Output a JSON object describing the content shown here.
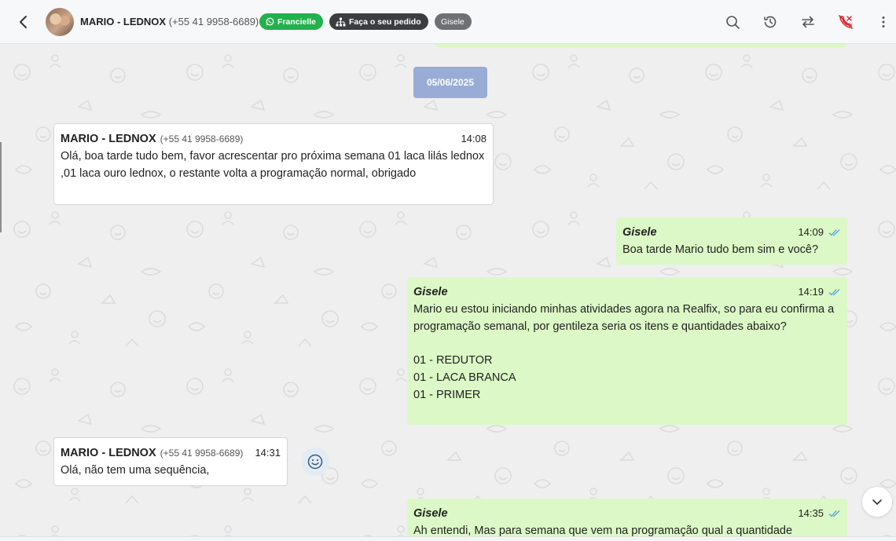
{
  "header": {
    "contact_name": "MARIO - LEDNOX",
    "contact_phone": "(+55 41 9958-6689)",
    "tag_whatsapp": "Francielle",
    "tag_order": "Faça o seu pedido",
    "tag_user": "Gisele",
    "icons": [
      "back-icon",
      "search-icon",
      "history-icon",
      "transfer-icon",
      "end-call-icon",
      "more-icon"
    ],
    "accent_color": "#22b14c",
    "danger_color": "#d9262b"
  },
  "chat": {
    "date_separator": "05/06/2025",
    "messages": [
      {
        "direction": "in",
        "sender": "MARIO - LEDNOX",
        "phone": "(+55 41 9958-6689)",
        "time": "14:08",
        "text": "Olá, boa tarde tudo bem, favor acrescentar pro próxima semana 01 laca lilás lednox ,01 laca ouro lednox, o restante volta a programação normal, obrigado"
      },
      {
        "direction": "out",
        "sender": "Gisele",
        "time": "14:09",
        "text": "Boa tarde Mario tudo bem sim e você?"
      },
      {
        "direction": "out",
        "sender": "Gisele",
        "time": "14:19",
        "text": "Mario eu estou iniciando minhas atividades agora na Realfix, so para eu confirma a programação semanal, por gentileza seria os itens e quantidades abaixo?\n\n01 - REDUTOR\n01 - LACA BRANCA\n01 - PRIMER"
      },
      {
        "direction": "in",
        "sender": "MARIO - LEDNOX",
        "phone": "(+55 41 9958-6689)",
        "time": "14:31",
        "text": "Olá, não tem uma sequência,"
      },
      {
        "direction": "out",
        "sender": "Gisele",
        "time": "14:35",
        "text": "Ah entendi, Mas para semana que vem na programação qual a quantidade"
      }
    ]
  }
}
